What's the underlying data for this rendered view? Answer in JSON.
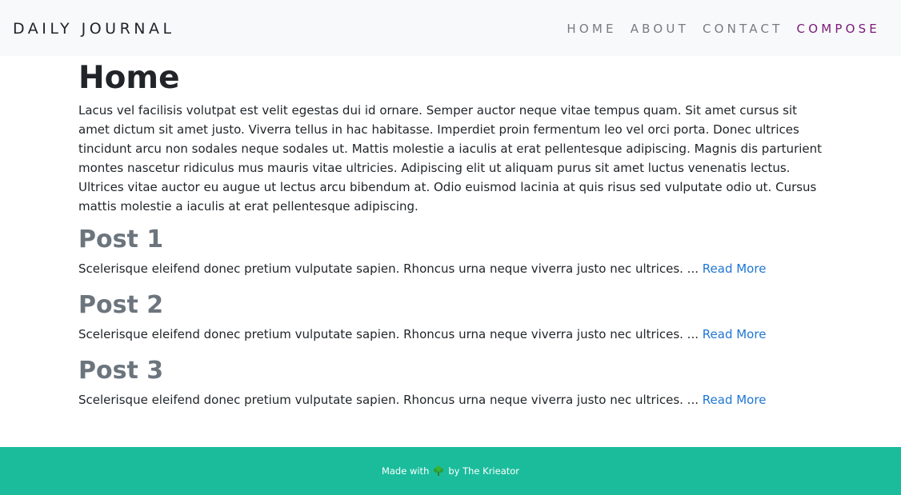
{
  "header": {
    "brand": "DAILY JOURNAL",
    "nav": [
      {
        "label": "HOME"
      },
      {
        "label": "ABOUT"
      },
      {
        "label": "CONTACT"
      },
      {
        "label": "COMPOSE"
      }
    ]
  },
  "main": {
    "title": "Home",
    "intro": "Lacus vel facilisis volutpat est velit egestas dui id ornare. Semper auctor neque vitae tempus quam. Sit amet cursus sit amet dictum sit amet justo. Viverra tellus in hac habitasse. Imperdiet proin fermentum leo vel orci porta. Donec ultrices tincidunt arcu non sodales neque sodales ut. Mattis molestie a iaculis at erat pellentesque adipiscing. Magnis dis parturient montes nascetur ridiculus mus mauris vitae ultricies. Adipiscing elit ut aliquam purus sit amet luctus venenatis lectus. Ultrices vitae auctor eu augue ut lectus arcu bibendum at. Odio euismod lacinia at quis risus sed vulputate odio ut. Cursus mattis molestie a iaculis at erat pellentesque adipiscing.",
    "posts": [
      {
        "title": "Post 1",
        "excerpt": "Scelerisque eleifend donec pretium vulputate sapien. Rhoncus urna neque viverra justo nec ultrices. ...",
        "link": "Read More"
      },
      {
        "title": "Post 2",
        "excerpt": "Scelerisque eleifend donec pretium vulputate sapien. Rhoncus urna neque viverra justo nec ultrices. ...",
        "link": "Read More"
      },
      {
        "title": "Post 3",
        "excerpt": "Scelerisque eleifend donec pretium vulputate sapien. Rhoncus urna neque viverra justo nec ultrices. ...",
        "link": "Read More"
      }
    ]
  },
  "footer": {
    "made_with": "Made with",
    "by": "by The Krieator",
    "icon": "broccoli-icon"
  },
  "colors": {
    "navbar_bg": "#f8f9fa",
    "active_nav": "#7a1a7a",
    "link": "#1f76d6",
    "footer_bg": "#1abc9c"
  }
}
